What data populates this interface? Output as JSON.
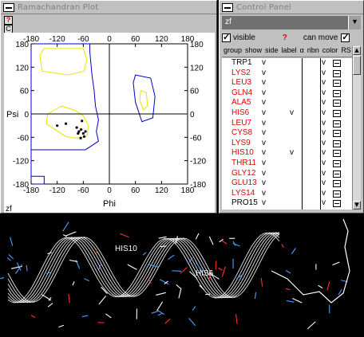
{
  "rama_window": {
    "title": "Ramachandran Plot",
    "help_label": "?",
    "c_label": "C",
    "footer_label": "zf"
  },
  "chart_data": {
    "type": "scatter",
    "xlabel": "Phi",
    "ylabel": "Psi",
    "xlim": [
      -180,
      180
    ],
    "ylim": [
      -180,
      180
    ],
    "x_ticks": [
      -180,
      -120,
      -60,
      0,
      60,
      120,
      180
    ],
    "y_ticks": [
      180,
      120,
      60,
      0,
      -60,
      -120,
      -180
    ],
    "points": [
      {
        "x": -63,
        "y": -18
      },
      {
        "x": -120,
        "y": -30
      },
      {
        "x": -100,
        "y": -25
      },
      {
        "x": -75,
        "y": -35
      },
      {
        "x": -70,
        "y": -45
      },
      {
        "x": -65,
        "y": -40
      },
      {
        "x": -60,
        "y": -50
      },
      {
        "x": -58,
        "y": -58
      },
      {
        "x": -72,
        "y": -50
      },
      {
        "x": -66,
        "y": -62
      },
      {
        "x": -55,
        "y": -45
      }
    ],
    "regions": {
      "outer_color": "#0000cc",
      "inner_color": "#e6e600"
    }
  },
  "ctrl_window": {
    "title": "Control Panel",
    "selected_name": "zf",
    "visible_label": "visible",
    "visible_checked": true,
    "help_label": "?",
    "can_move_label": "can move",
    "can_move_checked": true,
    "columns": [
      "group",
      "show",
      "side",
      "label",
      "α",
      "ribn",
      "color",
      "RS"
    ],
    "residues": [
      {
        "name": "TRP1",
        "color": "#000000",
        "show": "v",
        "label": "",
        "ribn": "v"
      },
      {
        "name": "LYS2",
        "color": "#e00000",
        "show": "v",
        "label": "",
        "ribn": "v"
      },
      {
        "name": "LEU3",
        "color": "#e00000",
        "show": "v",
        "label": "",
        "ribn": "v"
      },
      {
        "name": "GLN4",
        "color": "#e00000",
        "show": "v",
        "label": "",
        "ribn": "v"
      },
      {
        "name": "ALA5",
        "color": "#e00000",
        "show": "v",
        "label": "",
        "ribn": "v"
      },
      {
        "name": "HIS6",
        "color": "#e00000",
        "show": "v",
        "label": "v",
        "ribn": "v"
      },
      {
        "name": "LEU7",
        "color": "#e00000",
        "show": "v",
        "label": "",
        "ribn": "v"
      },
      {
        "name": "CYS8",
        "color": "#e00000",
        "show": "v",
        "label": "",
        "ribn": "v"
      },
      {
        "name": "LYS9",
        "color": "#e00000",
        "show": "v",
        "label": "",
        "ribn": "v"
      },
      {
        "name": "HIS10",
        "color": "#e00000",
        "show": "v",
        "label": "v",
        "ribn": "v"
      },
      {
        "name": "THR11",
        "color": "#e00000",
        "show": "v",
        "label": "",
        "ribn": "v"
      },
      {
        "name": "GLY12",
        "color": "#e00000",
        "show": "v",
        "label": "",
        "ribn": "v"
      },
      {
        "name": "GLU13",
        "color": "#e00000",
        "show": "v",
        "label": "",
        "ribn": "v"
      },
      {
        "name": "LYS14",
        "color": "#e00000",
        "show": "v",
        "label": "",
        "ribn": "v"
      },
      {
        "name": "PRO15",
        "color": "#000000",
        "show": "v",
        "label": "",
        "ribn": "v"
      }
    ]
  },
  "structure_view": {
    "labels": [
      "HIS10",
      "HIS6"
    ]
  }
}
